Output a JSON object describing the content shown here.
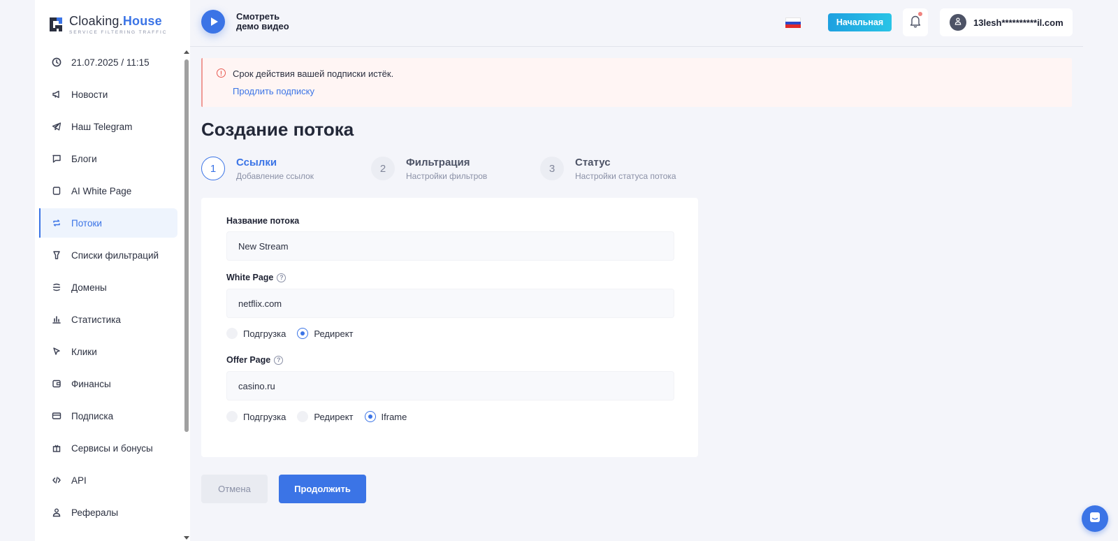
{
  "brand": {
    "name_part1": "Cloaking.",
    "name_part2": "House",
    "tagline": "SERVICE FILTERING TRAFFIC",
    "accent": "#3b74e6"
  },
  "sidebar": {
    "items": [
      {
        "label": "21.07.2025 / 11:15",
        "icon": "clock-icon"
      },
      {
        "label": "Новости",
        "icon": "megaphone-icon"
      },
      {
        "label": "Наш Telegram",
        "icon": "telegram-icon"
      },
      {
        "label": "Блоги",
        "icon": "chat-bubble-icon"
      },
      {
        "label": "AI White Page",
        "icon": "page-icon"
      },
      {
        "label": "Потоки",
        "icon": "refresh-icon",
        "active": true
      },
      {
        "label": "Списки фильтраций",
        "icon": "filter-icon"
      },
      {
        "label": "Домены",
        "icon": "globe-icon"
      },
      {
        "label": "Статистика",
        "icon": "bar-chart-icon"
      },
      {
        "label": "Клики",
        "icon": "cursor-icon"
      },
      {
        "label": "Финансы",
        "icon": "wallet-icon"
      },
      {
        "label": "Подписка",
        "icon": "card-icon"
      },
      {
        "label": "Сервисы и бонусы",
        "icon": "gift-icon"
      },
      {
        "label": "API",
        "icon": "code-icon"
      },
      {
        "label": "Рефералы",
        "icon": "user-icon"
      }
    ]
  },
  "topbar": {
    "demo_line1": "Смотреть",
    "demo_line2": "демо видео",
    "home_button": "Начальная",
    "user_email": "13lesh**********il.com"
  },
  "alert": {
    "message": "Срок действия вашей подписки истёк.",
    "link": "Продлить подписку"
  },
  "page": {
    "title": "Создание потока"
  },
  "steps": [
    {
      "num": "1",
      "title": "Ссылки",
      "subtitle": "Добавление ссылок",
      "active": true
    },
    {
      "num": "2",
      "title": "Фильтрация",
      "subtitle": "Настройки фильтров",
      "active": false
    },
    {
      "num": "3",
      "title": "Статус",
      "subtitle": "Настройки статуса потока",
      "active": false
    }
  ],
  "form": {
    "stream_name_label": "Название потока",
    "stream_name_value": "New Stream",
    "white_page_label": "White Page",
    "white_page_value": "netflix.com",
    "white_page_options": [
      "Подгрузка",
      "Редирект"
    ],
    "white_page_selected": "Редирект",
    "offer_page_label": "Offer Page",
    "offer_page_value": "casino.ru",
    "offer_page_options": [
      "Подгрузка",
      "Редирект",
      "Iframe"
    ],
    "offer_page_selected": "Iframe"
  },
  "actions": {
    "cancel": "Отмена",
    "continue": "Продолжить"
  }
}
